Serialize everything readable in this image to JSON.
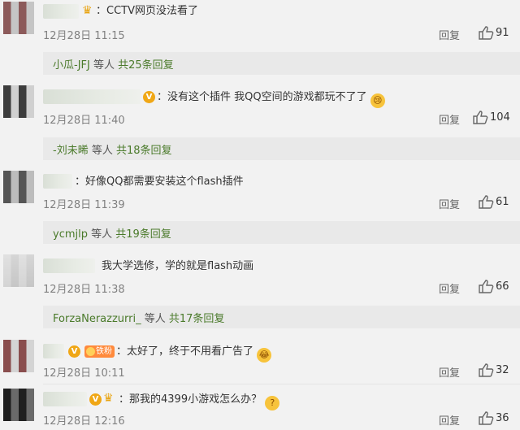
{
  "comments": [
    {
      "text": "：CCTV网页没法看了",
      "time": "12月28日 11:15",
      "reply": "回复",
      "likes": "91",
      "replies": {
        "name": "小瓜-JFJ",
        "mid": " 等人 ",
        "link": "共25条回复"
      }
    },
    {
      "text": "：没有这个插件 我QQ空间的游戏都玩不了了",
      "time": "12月28日 11:40",
      "reply": "回复",
      "likes": "104",
      "replies": {
        "name": "-刘未晞",
        "mid": " 等人 ",
        "link": "共18条回复"
      }
    },
    {
      "text": "：好像QQ都需要安装这个flash插件",
      "time": "12月28日 11:39",
      "reply": "回复",
      "likes": "61",
      "replies": {
        "name": "ycmjlp",
        "mid": " 等人 ",
        "link": "共19条回复"
      }
    },
    {
      "text": "我大学选修，学的就是flash动画",
      "time": "12月28日 11:38",
      "reply": "回复",
      "likes": "66",
      "replies": {
        "name": "ForzaNerazzurri_",
        "mid": " 等人 ",
        "link": "共17条回复"
      }
    },
    {
      "text": "：太好了，终于不用看广告了",
      "time": "12月28日 10:11",
      "reply": "回复",
      "likes": "32",
      "fan_badge": "铁粉"
    },
    {
      "text": "：那我的4399小游戏怎么办？",
      "time": "12月28日 12:16",
      "reply": "回复",
      "likes": "36"
    }
  ],
  "icons": {
    "like": "thumbs-up-icon",
    "verified": "verified-v-icon",
    "crown": "crown-icon",
    "emoji": "emoji-icon"
  },
  "colors": {
    "reply_link": "#4a7a2a",
    "badge": "#f0a716"
  }
}
